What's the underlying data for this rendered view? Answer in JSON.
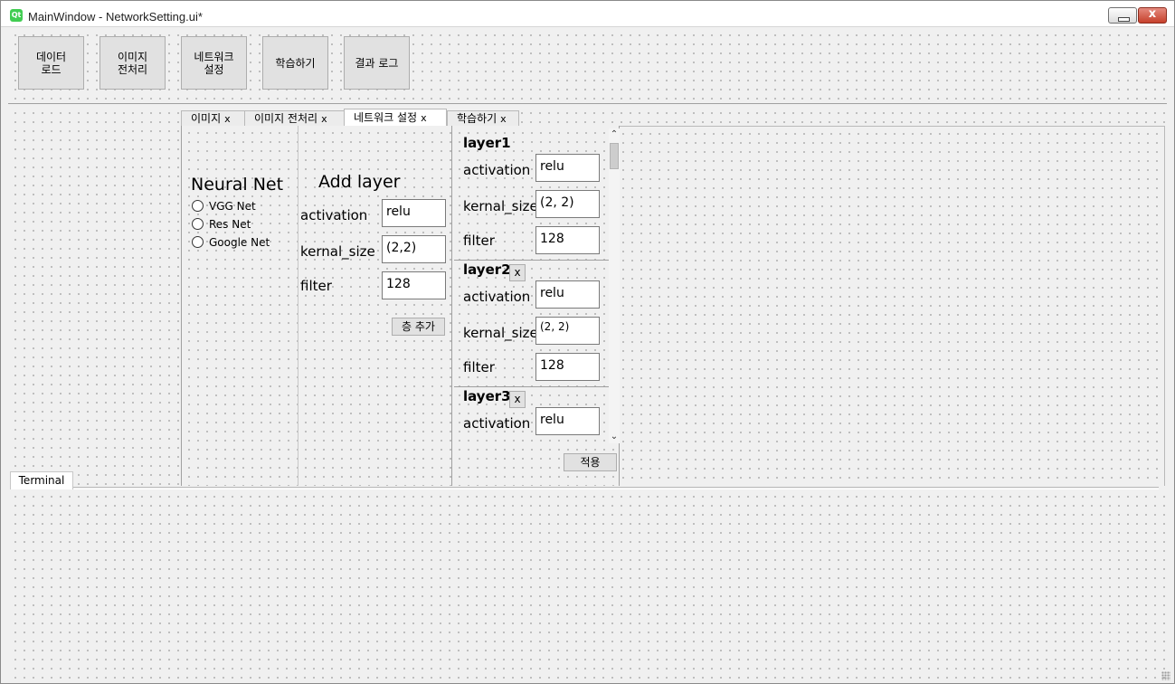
{
  "window": {
    "title": "MainWindow - NetworkSetting.ui*",
    "app_icon": "Qt",
    "minimize_label": "",
    "close_label": "x"
  },
  "toolbar": {
    "buttons": [
      {
        "label": "데이터\n로드"
      },
      {
        "label": "이미지\n전처리"
      },
      {
        "label": "네트워크\n설정"
      },
      {
        "label": "학습하기"
      },
      {
        "label": "결과 로그"
      }
    ]
  },
  "tabs": [
    {
      "label": "이미지",
      "close": "x"
    },
    {
      "label": "이미지 전처리",
      "close": "x"
    },
    {
      "label": "네트워크 설정",
      "close": "x",
      "active": true
    },
    {
      "label": "학습하기",
      "close": "x"
    }
  ],
  "neural_net": {
    "heading": "Neural Net",
    "options": [
      "VGG Net",
      "Res Net",
      "Google Net"
    ]
  },
  "add_layer": {
    "heading": "Add layer",
    "activation_label": "activation",
    "activation_value": "relu",
    "kernal_label": "kernal_size",
    "kernal_value": "(2,2)",
    "filter_label": "filter",
    "filter_value": "128",
    "add_button": "층 추가"
  },
  "layers": [
    {
      "title": "layer1",
      "activation_label": "activation",
      "activation_value": "relu",
      "kernal_label": "kernal_size",
      "kernal_value": "(2, 2)",
      "filter_label": "filter",
      "filter_value": "128"
    },
    {
      "title": "layer2",
      "remove": "x",
      "activation_label": "activation",
      "activation_value": "relu",
      "kernal_label": "kernal_size",
      "kernal_value": "(2, 2)",
      "filter_label": "filter",
      "filter_value": "128"
    },
    {
      "title": "layer3",
      "remove": "x",
      "activation_label": "activation",
      "activation_value": "relu"
    }
  ],
  "apply_button": "적용",
  "terminal": {
    "tab_label": "Terminal"
  },
  "colors": {
    "close_button": "#c6402b",
    "qt_icon": "#41cd52",
    "background": "#f0f0f0"
  }
}
